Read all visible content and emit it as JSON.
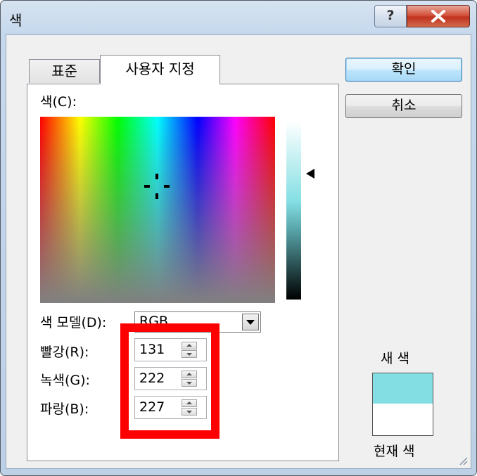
{
  "window": {
    "title": "색"
  },
  "caption": {
    "help": "?",
    "close": "×"
  },
  "tabs": {
    "standard": "표준",
    "custom": "사용자 지정"
  },
  "color_label": "색(C):",
  "model": {
    "label": "색 모델(D):",
    "value": "RGB"
  },
  "red": {
    "label": "빨강(R):",
    "value": "131"
  },
  "green": {
    "label": "녹색(G):",
    "value": "222"
  },
  "blue": {
    "label": "파랑(B):",
    "value": "227"
  },
  "buttons": {
    "ok": "확인",
    "cancel": "취소"
  },
  "preview": {
    "new_label": "새 색",
    "current_label": "현재 색",
    "new_color": "#83DEE3",
    "current_color": "#FFFFFF"
  },
  "colors": {
    "highlight": "#FF0000",
    "close_button": "#C1321E"
  }
}
